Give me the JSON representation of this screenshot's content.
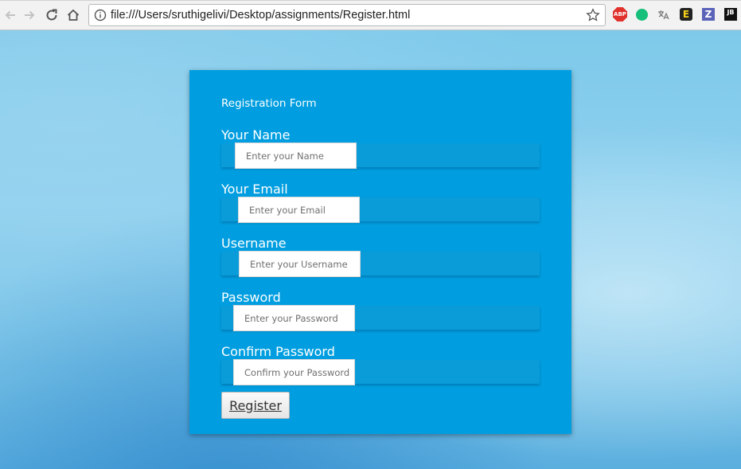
{
  "browser": {
    "url": "file:///Users/sruthigelivi/Desktop/assignments/Register.html",
    "extensions": [
      "abp-icon",
      "grammarly-icon",
      "translate-icon",
      "evernote-icon",
      "zotero-icon",
      "jetbrains-icon"
    ],
    "abp_label": "ABP",
    "e_label": "E",
    "z_label": "Z",
    "jb_label": "JB"
  },
  "form": {
    "title": "Registration Form",
    "fields": [
      {
        "label": "Your Name",
        "placeholder": "Enter your Name",
        "value": ""
      },
      {
        "label": "Your Email",
        "placeholder": "Enter your Email",
        "value": ""
      },
      {
        "label": "Username",
        "placeholder": "Enter your Username",
        "value": ""
      },
      {
        "label": "Password",
        "placeholder": "Enter your Password",
        "value": ""
      },
      {
        "label": "Confirm Password",
        "placeholder": "Confirm your Password",
        "value": ""
      }
    ],
    "submit_label": "Register"
  },
  "colors": {
    "card": "#009ee0",
    "page": "#7ec9ea"
  }
}
